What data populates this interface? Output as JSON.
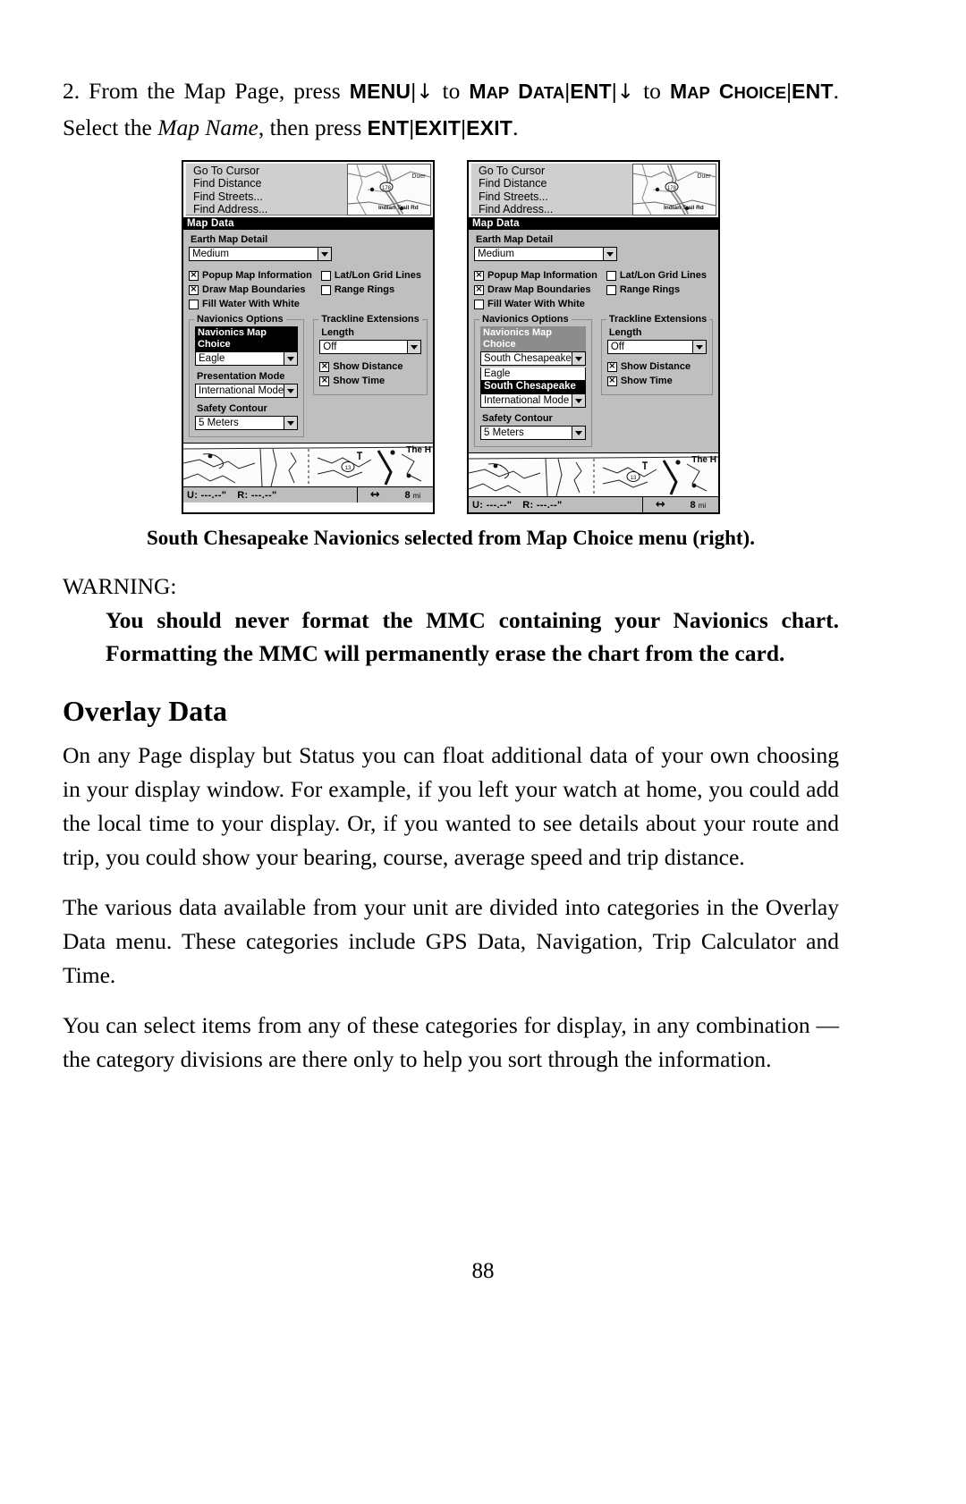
{
  "step": {
    "number": "2.",
    "part1": "From the Map Page, press",
    "key_menu": "MENU",
    "sep": "|",
    "arrow_down": "↓",
    "to1": "to",
    "sc_map_data_cap1": "M",
    "sc_map_data_rest1": "AP",
    "sc_map_data_cap2": "D",
    "sc_map_data_rest2": "ATA",
    "key_ent1": "ENT",
    "to2": "to",
    "sc_map_cap": "M",
    "sc_map_rest": "AP",
    "sc_choice_cap": "C",
    "sc_choice_rest": "HOICE",
    "key_ent2": "ENT",
    "part2": ". Select the",
    "italic_map_name": "Map Name",
    "part3": ", then press",
    "key_ent3": "ENT",
    "key_exit1": "EXIT",
    "key_exit2": "EXIT",
    "period": "."
  },
  "device_left": {
    "menu_items": [
      "Go To Cursor",
      "Find Distance",
      "Find Streets...",
      "Find Address..."
    ],
    "mini_map": {
      "route_label": "178",
      "street_label": "Indian Trail Rd",
      "corner_label": "Duer"
    },
    "titlebar": "Map Data",
    "earth_map_detail_label": "Earth Map Detail",
    "earth_map_detail_value": "Medium",
    "checkboxes": [
      {
        "label": "Popup Map Information",
        "checked": true
      },
      {
        "label": "Lat/Lon Grid Lines",
        "checked": false
      },
      {
        "label": "Draw Map Boundaries",
        "checked": true
      },
      {
        "label": "Range Rings",
        "checked": false
      },
      {
        "label": "Fill Water With White",
        "checked": false
      }
    ],
    "navionics_group_title": "Navionics Options",
    "navionics_map_choice_label": "Navionics Map Choice",
    "navionics_map_choice_value": "Eagle",
    "presentation_mode_label": "Presentation Mode",
    "presentation_mode_value": "International Mode",
    "safety_contour_label": "Safety Contour",
    "safety_contour_value": "5 Meters",
    "trackline_group_title": "Trackline Extensions",
    "length_label": "Length",
    "length_value": "Off",
    "show_distance_label": "Show Distance",
    "show_distance_checked": true,
    "show_time_label": "Show Time",
    "show_time_checked": true,
    "map_label": "The H",
    "map_hwy": "13",
    "status_u": "U:  ---.--\"",
    "status_r": "R:  ---.--\"",
    "status_range": "8",
    "status_unit": "mi",
    "status_arrow": "↔"
  },
  "device_right": {
    "menu_items": [
      "Go To Cursor",
      "Find Distance",
      "Find Streets...",
      "Find Address..."
    ],
    "mini_map": {
      "route_label": "178",
      "street_label": "Indian Trail Rd",
      "corner_label": "Duer"
    },
    "titlebar": "Map Data",
    "earth_map_detail_label": "Earth Map Detail",
    "earth_map_detail_value": "Medium",
    "checkboxes": [
      {
        "label": "Popup Map Information",
        "checked": true
      },
      {
        "label": "Lat/Lon Grid Lines",
        "checked": false
      },
      {
        "label": "Draw Map Boundaries",
        "checked": true
      },
      {
        "label": "Range Rings",
        "checked": false
      },
      {
        "label": "Fill Water With White",
        "checked": false
      }
    ],
    "navionics_group_title": "Navionics Options",
    "navionics_map_choice_label": "Navionics Map Choice",
    "navionics_map_choice_value": "South Chesapeake",
    "dropdown_options": [
      {
        "label": "Eagle",
        "selected": false
      },
      {
        "label": "South Chesapeake",
        "selected": true
      }
    ],
    "presentation_mode_value": "International Mode",
    "safety_contour_label": "Safety Contour",
    "safety_contour_value": "5 Meters",
    "trackline_group_title": "Trackline Extensions",
    "length_label": "Length",
    "length_value": "Off",
    "show_distance_label": "Show Distance",
    "show_distance_checked": true,
    "show_time_label": "Show Time",
    "show_time_checked": true,
    "map_label": "The H",
    "map_hwy": "13",
    "status_u": "U:  ---.--\"",
    "status_r": "R:  ---.--\"",
    "status_range": "8",
    "status_unit": "mi",
    "status_arrow": "↔"
  },
  "caption": "South Chesapeake Navionics selected from Map Choice menu (right).",
  "warning": {
    "title": "WARNING:",
    "body": "You should never format the MMC containing your Navionics chart. Formatting the MMC will permanently erase the chart from the card."
  },
  "section": {
    "heading": "Overlay Data",
    "paragraphs": [
      "On any Page display but Status you can float additional data of your own choosing in your display window. For example, if you left your watch at home, you could add the local time to your display. Or, if you wanted to see details about your route and trip, you could show your bearing, course, average speed and trip distance.",
      "The various data available from your unit are divided into categories in the Overlay Data menu. These categories include GPS Data, Navigation, Trip Calculator and Time.",
      "You can select items from any of these categories for display, in any combination — the category divisions are there only to help you sort through the information."
    ]
  },
  "page_number": "88"
}
